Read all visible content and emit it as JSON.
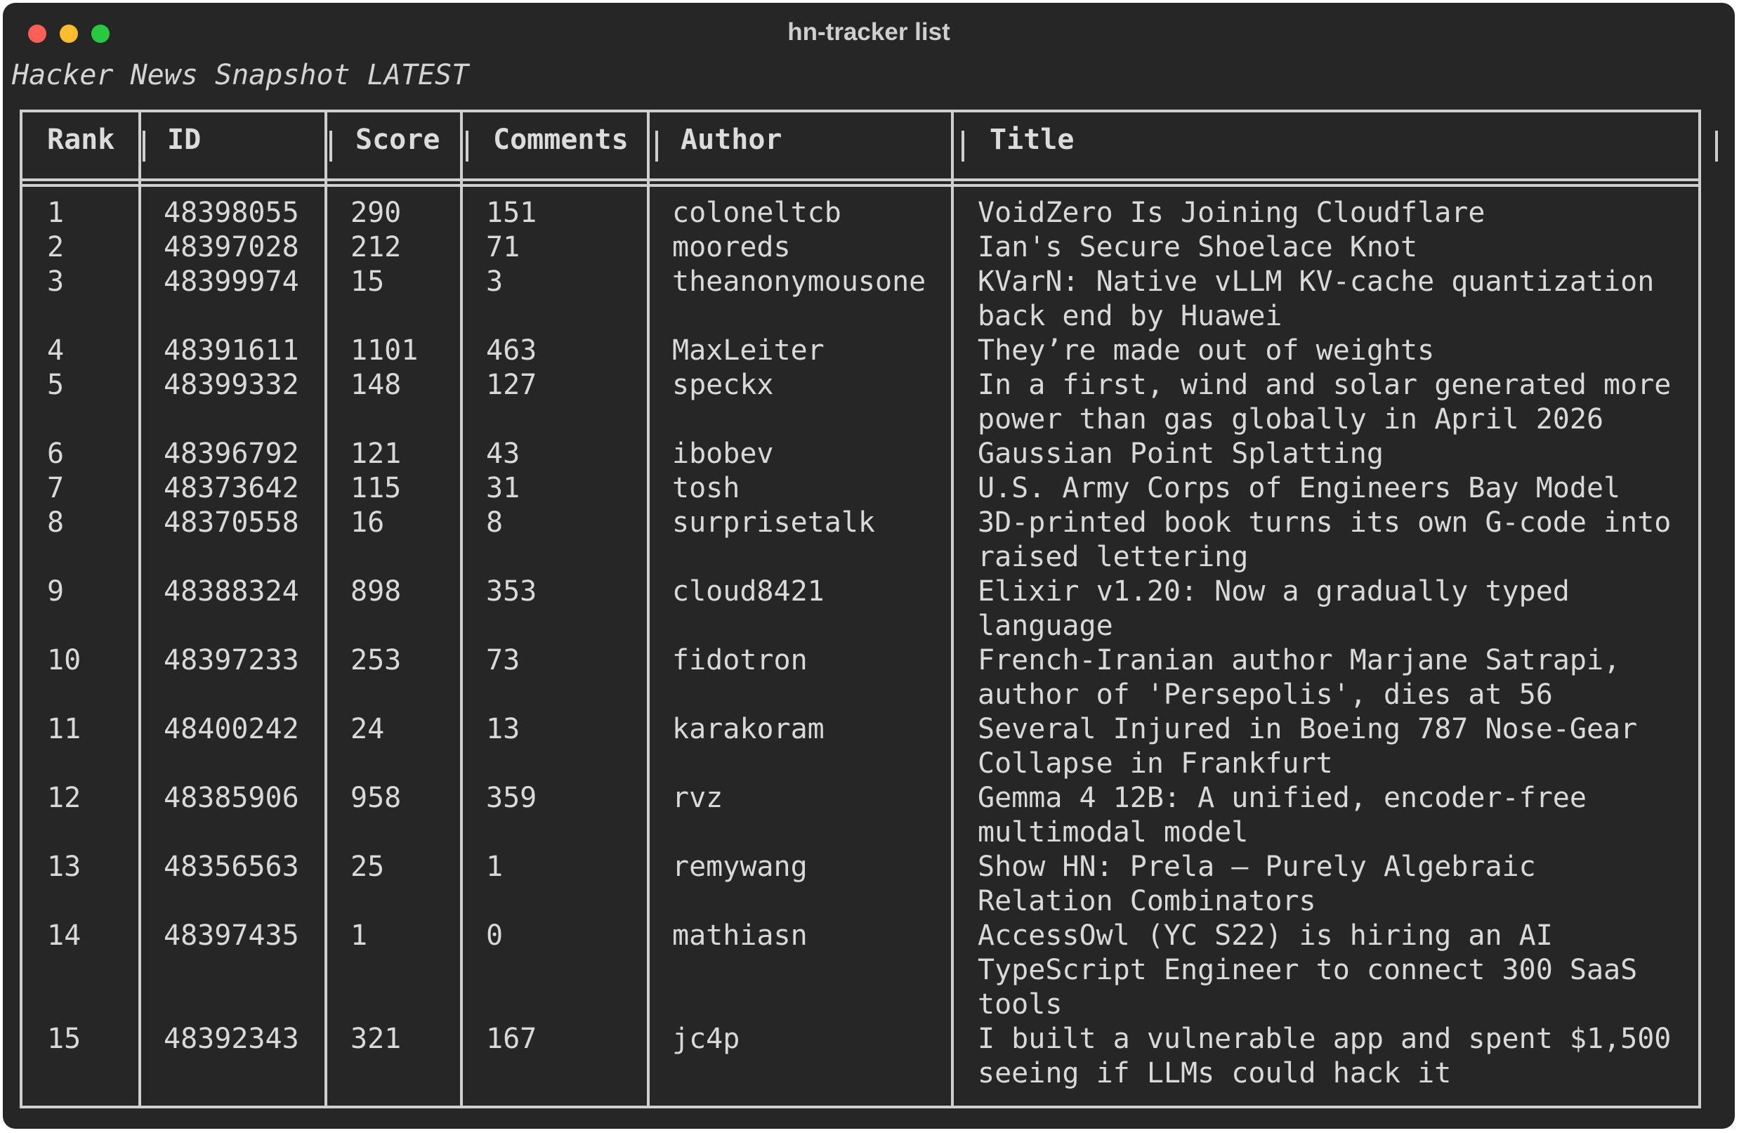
{
  "window": {
    "title": "hn-tracker list"
  },
  "heading": "Hacker News Snapshot LATEST",
  "columns": [
    "Rank",
    "ID",
    "Score",
    "Comments",
    "Author",
    "Title"
  ],
  "rows": [
    {
      "rank": "1",
      "id": "48398055",
      "score": "290",
      "comments": "151",
      "author": "coloneltcb",
      "title": [
        "VoidZero Is Joining Cloudflare"
      ]
    },
    {
      "rank": "2",
      "id": "48397028",
      "score": "212",
      "comments": "71",
      "author": "mooreds",
      "title": [
        "Ian's Secure Shoelace Knot"
      ]
    },
    {
      "rank": "3",
      "id": "48399974",
      "score": "15",
      "comments": "3",
      "author": "theanonymousone",
      "title": [
        "KVarN: Native vLLM KV-cache quantization",
        "back end by Huawei"
      ]
    },
    {
      "rank": "4",
      "id": "48391611",
      "score": "1101",
      "comments": "463",
      "author": "MaxLeiter",
      "title": [
        "They’re made out of weights"
      ]
    },
    {
      "rank": "5",
      "id": "48399332",
      "score": "148",
      "comments": "127",
      "author": "speckx",
      "title": [
        "In a first, wind and solar generated more",
        "power than gas globally in April 2026"
      ]
    },
    {
      "rank": "6",
      "id": "48396792",
      "score": "121",
      "comments": "43",
      "author": "ibobev",
      "title": [
        "Gaussian Point Splatting"
      ]
    },
    {
      "rank": "7",
      "id": "48373642",
      "score": "115",
      "comments": "31",
      "author": "tosh",
      "title": [
        "U.S. Army Corps of Engineers Bay Model"
      ]
    },
    {
      "rank": "8",
      "id": "48370558",
      "score": "16",
      "comments": "8",
      "author": "surprisetalk",
      "title": [
        "3D-printed book turns its own G-code into",
        "raised lettering"
      ]
    },
    {
      "rank": "9",
      "id": "48388324",
      "score": "898",
      "comments": "353",
      "author": "cloud8421",
      "title": [
        "Elixir v1.20: Now a gradually typed",
        "language"
      ]
    },
    {
      "rank": "10",
      "id": "48397233",
      "score": "253",
      "comments": "73",
      "author": "fidotron",
      "title": [
        "French-Iranian author Marjane Satrapi,",
        "author of 'Persepolis', dies at 56"
      ]
    },
    {
      "rank": "11",
      "id": "48400242",
      "score": "24",
      "comments": "13",
      "author": "karakoram",
      "title": [
        "Several Injured in Boeing 787 Nose-Gear",
        "Collapse in Frankfurt"
      ]
    },
    {
      "rank": "12",
      "id": "48385906",
      "score": "958",
      "comments": "359",
      "author": "rvz",
      "title": [
        "Gemma 4 12B: A unified, encoder-free",
        "multimodal model"
      ]
    },
    {
      "rank": "13",
      "id": "48356563",
      "score": "25",
      "comments": "1",
      "author": "remywang",
      "title": [
        "Show HN: Prela – Purely Algebraic",
        "Relation Combinators"
      ]
    },
    {
      "rank": "14",
      "id": "48397435",
      "score": "1",
      "comments": "0",
      "author": "mathiasn",
      "title": [
        "AccessOwl (YC S22) is hiring an AI",
        "TypeScript Engineer to connect 300 SaaS",
        "tools"
      ]
    },
    {
      "rank": "15",
      "id": "48392343",
      "score": "321",
      "comments": "167",
      "author": "jc4p",
      "title": [
        "I built a vulnerable app and spent $1,500",
        "seeing if LLMs could hack it"
      ]
    }
  ]
}
